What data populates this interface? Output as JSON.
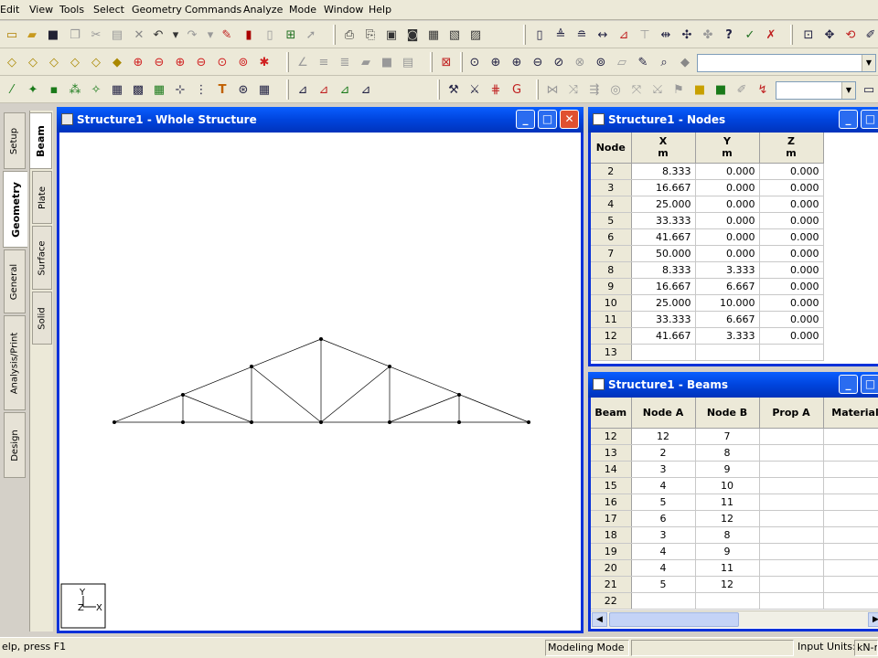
{
  "menu": [
    "Edit",
    "View",
    "Tools",
    "Select",
    "Geometry",
    "Commands",
    "Analyze",
    "Mode",
    "Window",
    "Help"
  ],
  "left_tabs": {
    "main": [
      "Setup",
      "Geometry",
      "General",
      "Analysis/Print",
      "Design"
    ],
    "sub": [
      "Beam",
      "Plate",
      "Surface",
      "Solid"
    ],
    "active_main": "Geometry",
    "active_sub": "Beam"
  },
  "structure_window": {
    "title": "Structure1 - Whole Structure",
    "axis": {
      "y": "Y",
      "z": "Z",
      "x": "X"
    }
  },
  "nodes_window": {
    "title": "Structure1 - Nodes",
    "headers": [
      {
        "top": "Node",
        "bottom": ""
      },
      {
        "top": "X",
        "bottom": "m"
      },
      {
        "top": "Y",
        "bottom": "m"
      },
      {
        "top": "Z",
        "bottom": "m"
      }
    ],
    "rows": [
      [
        "2",
        "8.333",
        "0.000",
        "0.000"
      ],
      [
        "3",
        "16.667",
        "0.000",
        "0.000"
      ],
      [
        "4",
        "25.000",
        "0.000",
        "0.000"
      ],
      [
        "5",
        "33.333",
        "0.000",
        "0.000"
      ],
      [
        "6",
        "41.667",
        "0.000",
        "0.000"
      ],
      [
        "7",
        "50.000",
        "0.000",
        "0.000"
      ],
      [
        "8",
        "8.333",
        "3.333",
        "0.000"
      ],
      [
        "9",
        "16.667",
        "6.667",
        "0.000"
      ],
      [
        "10",
        "25.000",
        "10.000",
        "0.000"
      ],
      [
        "11",
        "33.333",
        "6.667",
        "0.000"
      ],
      [
        "12",
        "41.667",
        "3.333",
        "0.000"
      ],
      [
        "13",
        "",
        "",
        ""
      ]
    ]
  },
  "beams_window": {
    "title": "Structure1 - Beams",
    "headers": [
      "Beam",
      "Node A",
      "Node B",
      "Prop A",
      "Material"
    ],
    "rows": [
      [
        "12",
        "12",
        "7",
        "",
        ""
      ],
      [
        "13",
        "2",
        "8",
        "",
        ""
      ],
      [
        "14",
        "3",
        "9",
        "",
        ""
      ],
      [
        "15",
        "4",
        "10",
        "",
        ""
      ],
      [
        "16",
        "5",
        "11",
        "",
        ""
      ],
      [
        "17",
        "6",
        "12",
        "",
        ""
      ],
      [
        "18",
        "3",
        "8",
        "",
        ""
      ],
      [
        "19",
        "4",
        "9",
        "",
        ""
      ],
      [
        "20",
        "4",
        "11",
        "",
        ""
      ],
      [
        "21",
        "5",
        "12",
        "",
        ""
      ],
      [
        "22",
        "",
        "",
        "",
        ""
      ]
    ]
  },
  "status": {
    "help": "elp, press F1",
    "mode": "Modeling Mode",
    "units_label": "Input Units:",
    "units_value": "kN-m"
  }
}
